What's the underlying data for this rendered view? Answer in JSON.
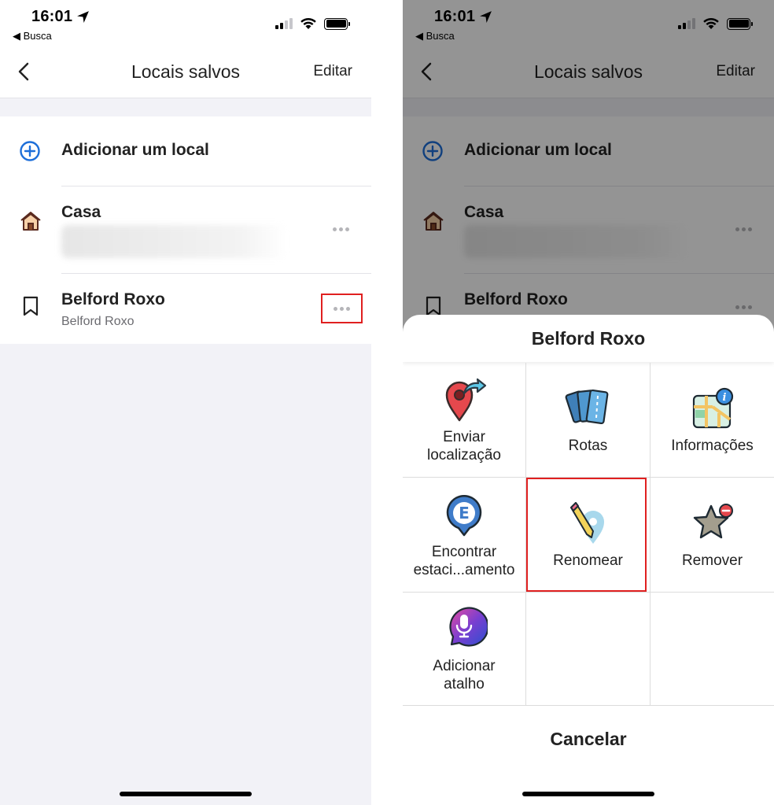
{
  "status_bar": {
    "time": "16:01",
    "back_app": "◀ Busca"
  },
  "nav": {
    "title": "Locais salvos",
    "edit_label": "Editar"
  },
  "list": {
    "add_label": "Adicionar um local",
    "home": {
      "title": "Casa"
    },
    "saved": {
      "title": "Belford Roxo",
      "subtitle": "Belford Roxo"
    }
  },
  "sheet": {
    "title": "Belford Roxo",
    "actions": [
      {
        "label": "Enviar\nlocalização",
        "icon": "send-location-icon"
      },
      {
        "label": "Rotas",
        "icon": "routes-cards-icon"
      },
      {
        "label": "Informações",
        "icon": "info-map-icon"
      },
      {
        "label": "Encontrar\nestaci...amento",
        "icon": "parking-icon"
      },
      {
        "label": "Renomear",
        "icon": "rename-pencil-icon",
        "highlighted": true
      },
      {
        "label": "Remover",
        "icon": "remove-star-icon"
      },
      {
        "label": "Adicionar\natalho",
        "icon": "microphone-icon"
      }
    ],
    "cancel_label": "Cancelar"
  },
  "colors": {
    "accent_blue": "#1e6fd9",
    "highlight_red": "#e02020",
    "dim_overlay": "rgba(0,0,0,0.42)"
  }
}
